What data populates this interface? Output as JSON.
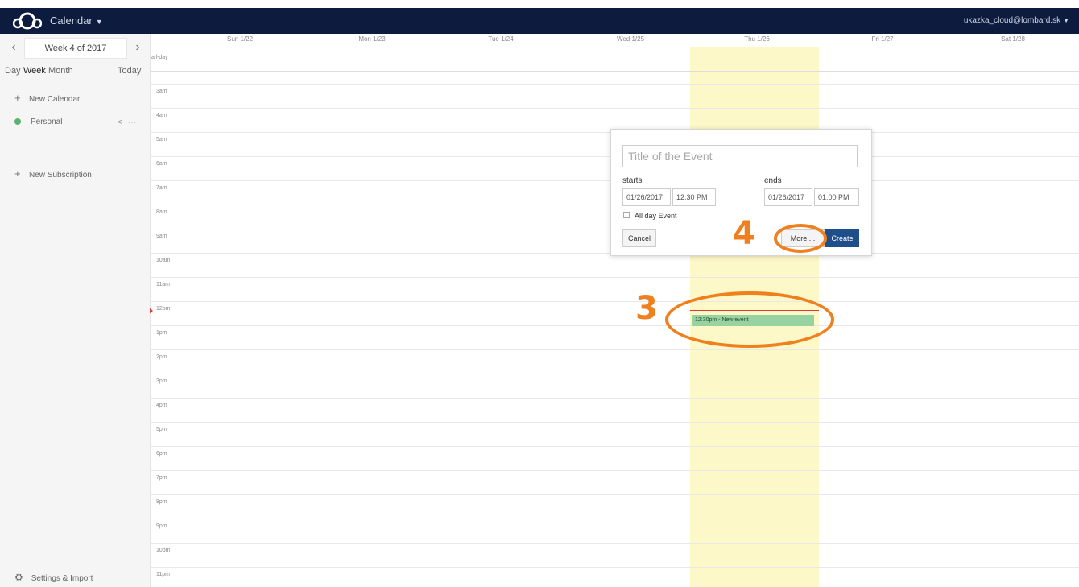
{
  "app": {
    "name": "Calendar",
    "user": "ukazka_cloud@lombard.sk"
  },
  "sidebar": {
    "week_label": "Week 4 of 2017",
    "views": {
      "day": "Day",
      "week": "Week",
      "month": "Month",
      "today": "Today"
    },
    "new_calendar": "New Calendar",
    "calendars": [
      {
        "name": "Personal",
        "color": "#5ab36c"
      }
    ],
    "new_subscription": "New Subscription",
    "settings": "Settings & Import"
  },
  "calendar": {
    "days": [
      "Sun 1/22",
      "Mon 1/23",
      "Tue 1/24",
      "Wed 1/25",
      "Thu 1/26",
      "Fri 1/27",
      "Sat 1/28"
    ],
    "allday_label": "all-day",
    "hours": [
      "3am",
      "4am",
      "5am",
      "6am",
      "7am",
      "8am",
      "9am",
      "10am",
      "11am",
      "12pm",
      "1pm",
      "2pm",
      "3pm",
      "4pm",
      "5pm",
      "6pm",
      "7pm",
      "8pm",
      "9pm",
      "10pm",
      "11pm"
    ],
    "event": "12:30pm - New event",
    "highlight_color": "#fdf8c8"
  },
  "popup": {
    "title_placeholder": "Title of the Event",
    "starts_label": "starts",
    "ends_label": "ends",
    "start_date": "01/26/2017",
    "start_time": "12:30 PM",
    "end_date": "01/26/2017",
    "end_time": "01:00 PM",
    "all_day": "All day Event",
    "cancel": "Cancel",
    "more": "More ...",
    "create": "Create"
  },
  "annotations": {
    "step3": "3",
    "step4": "4",
    "color": "#f07f1e"
  }
}
